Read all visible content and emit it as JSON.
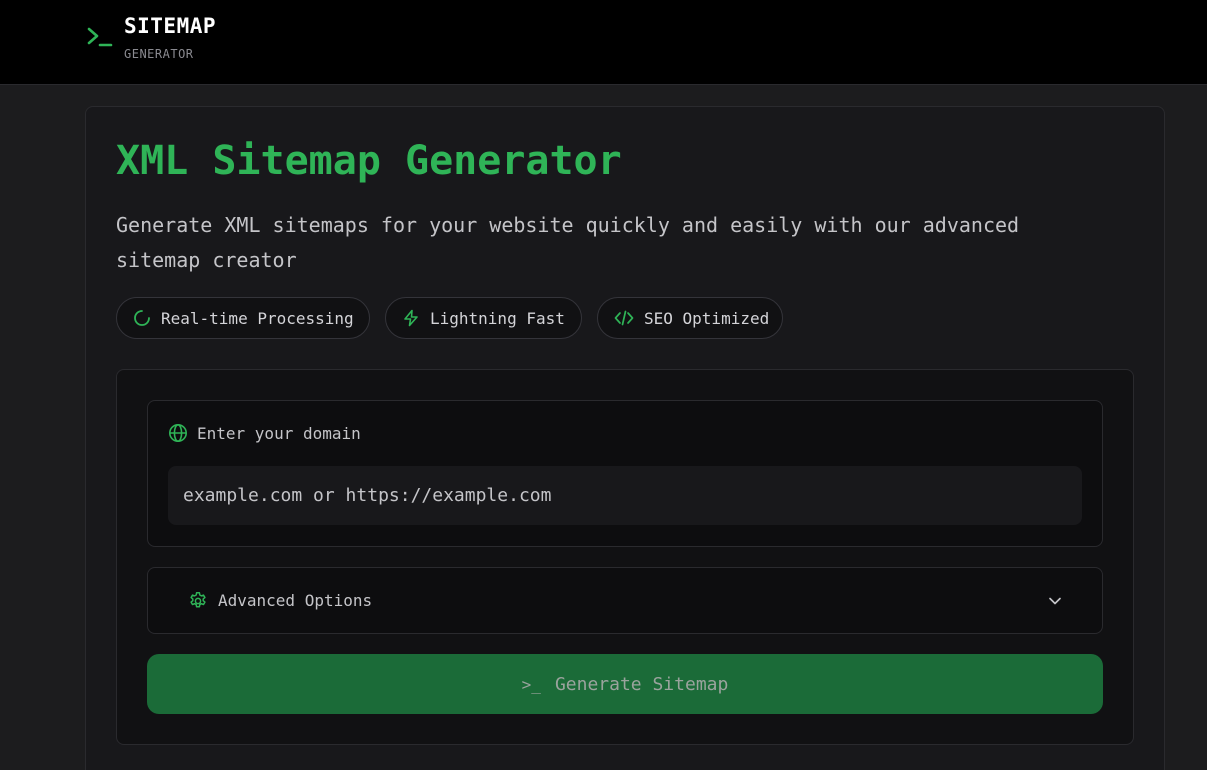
{
  "header": {
    "brand_title": "SITEMAP",
    "brand_subtitle": "GENERATOR",
    "logo_glyph": ">_"
  },
  "hero": {
    "title": "XML Sitemap Generator",
    "description": "Generate XML sitemaps for your website quickly and easily with our advanced sitemap creator"
  },
  "features": [
    {
      "label": "Real-time Processing",
      "icon": "loader-icon"
    },
    {
      "label": "Lightning Fast",
      "icon": "lightning-icon"
    },
    {
      "label": "SEO Optimized",
      "icon": "code-icon"
    }
  ],
  "form": {
    "domain_label": "Enter your domain",
    "domain_placeholder": "example.com or https://example.com",
    "domain_value": "",
    "advanced_label": "Advanced Options",
    "generate_label": "Generate Sitemap",
    "generate_icon_glyph": ">_"
  },
  "colors": {
    "accent": "#2fb457",
    "button_bg": "#1b6b38",
    "background": "#1c1c1e",
    "header_bg": "#000000"
  }
}
